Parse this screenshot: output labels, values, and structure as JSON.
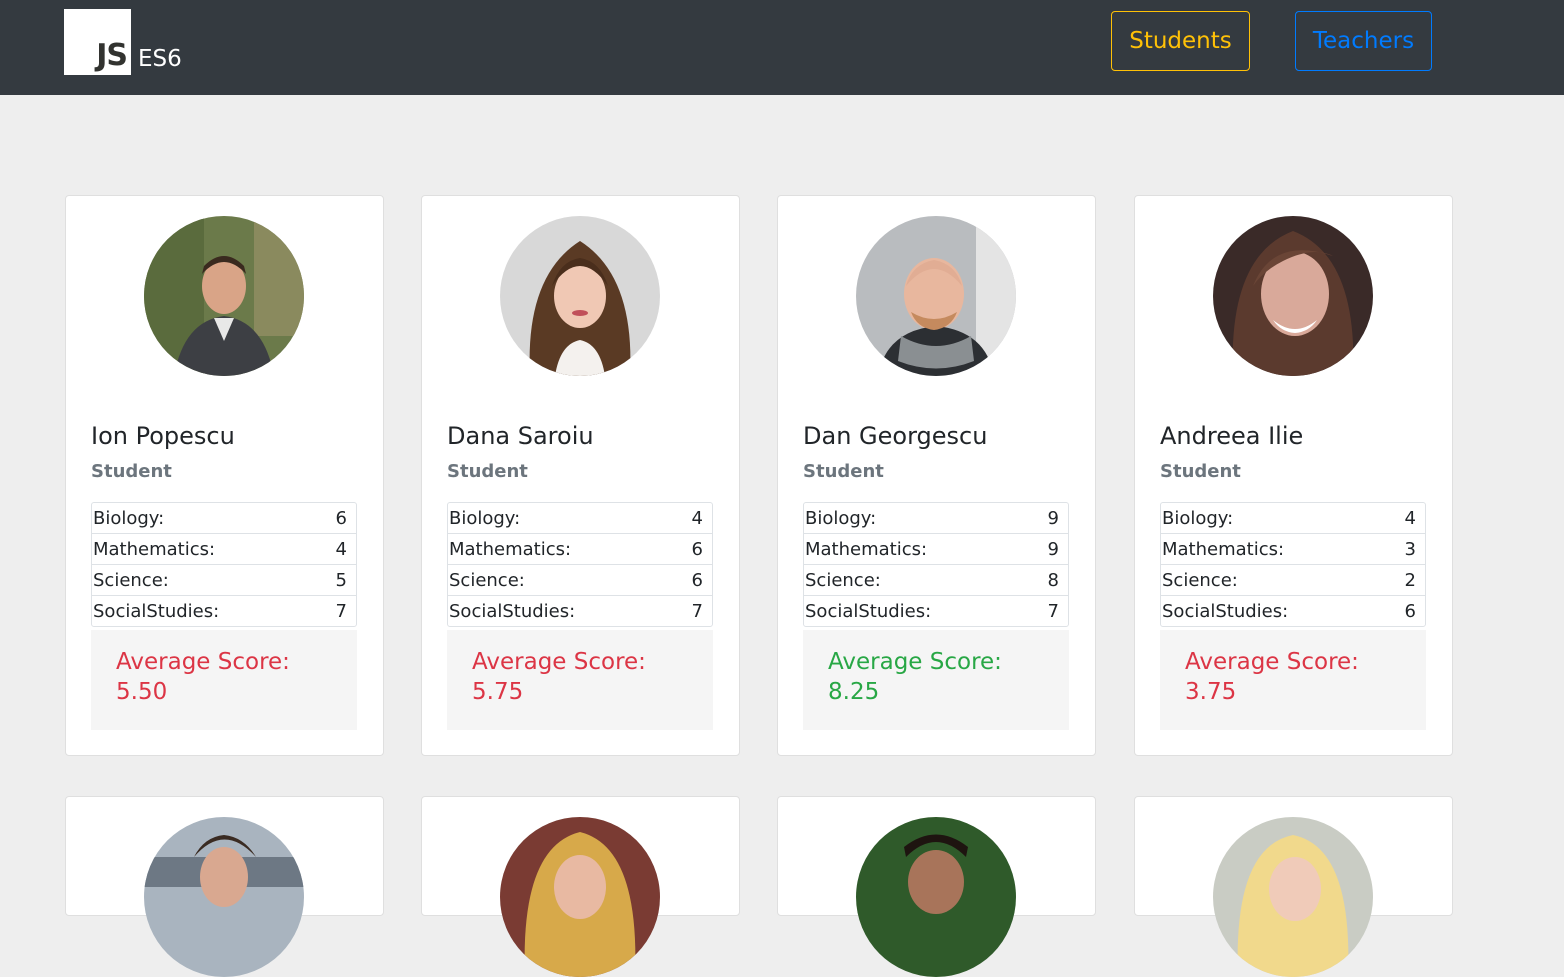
{
  "header": {
    "logo_text": "JS",
    "brand_label": "ES6",
    "nav": {
      "students_label": "Students",
      "teachers_label": "Teachers"
    }
  },
  "colors": {
    "navbar": "#343a40",
    "students_accent": "#ffc107",
    "teachers_accent": "#007bff",
    "avg_low": "#dc3545",
    "avg_high": "#28a745"
  },
  "cards": [
    {
      "name": "Ion Popescu",
      "role": "Student",
      "scores": [
        {
          "subject": "Biology:",
          "value": "6"
        },
        {
          "subject": "Mathematics:",
          "value": "4"
        },
        {
          "subject": "Science:",
          "value": "5"
        },
        {
          "subject": "SocialStudies:",
          "value": "7"
        }
      ],
      "average_label": "Average Score:",
      "average_value": "5.50"
    },
    {
      "name": "Dana Saroiu",
      "role": "Student",
      "scores": [
        {
          "subject": "Biology:",
          "value": "4"
        },
        {
          "subject": "Mathematics:",
          "value": "6"
        },
        {
          "subject": "Science:",
          "value": "6"
        },
        {
          "subject": "SocialStudies:",
          "value": "7"
        }
      ],
      "average_label": "Average Score:",
      "average_value": "5.75"
    },
    {
      "name": "Dan Georgescu",
      "role": "Student",
      "scores": [
        {
          "subject": "Biology:",
          "value": "9"
        },
        {
          "subject": "Mathematics:",
          "value": "9"
        },
        {
          "subject": "Science:",
          "value": "8"
        },
        {
          "subject": "SocialStudies:",
          "value": "7"
        }
      ],
      "average_label": "Average Score:",
      "average_value": "8.25"
    },
    {
      "name": "Andreea Ilie",
      "role": "Student",
      "scores": [
        {
          "subject": "Biology:",
          "value": "4"
        },
        {
          "subject": "Mathematics:",
          "value": "3"
        },
        {
          "subject": "Science:",
          "value": "2"
        },
        {
          "subject": "SocialStudies:",
          "value": "6"
        }
      ],
      "average_label": "Average Score:",
      "average_value": "3.75"
    }
  ]
}
